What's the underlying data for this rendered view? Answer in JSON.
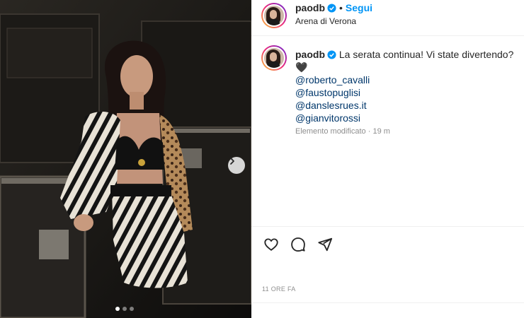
{
  "post": {
    "username": "paodb",
    "follow_label": "Segui",
    "separator": "•",
    "location": "Arena di Verona",
    "caption": "La serata continua! Vi state divertendo?🖤",
    "mentions": [
      "@roberto_cavalli",
      "@faustopuglisi",
      "@danslesrues.it",
      "@gianvitorossi"
    ],
    "edited_label": "Elemento modificato",
    "age": "19 m",
    "meta_sep": "·",
    "time_ago": "11 ORE FA"
  },
  "carousel": {
    "total": 3,
    "active": 1
  },
  "icons": {
    "verified": "verified-badge-icon",
    "next": "chevron-right-icon",
    "like": "heart-icon",
    "comment": "comment-icon",
    "share": "paper-plane-icon"
  },
  "colors": {
    "link": "#0095f6",
    "mention": "#00376b",
    "muted": "#8e8e8e",
    "text": "#262626"
  }
}
